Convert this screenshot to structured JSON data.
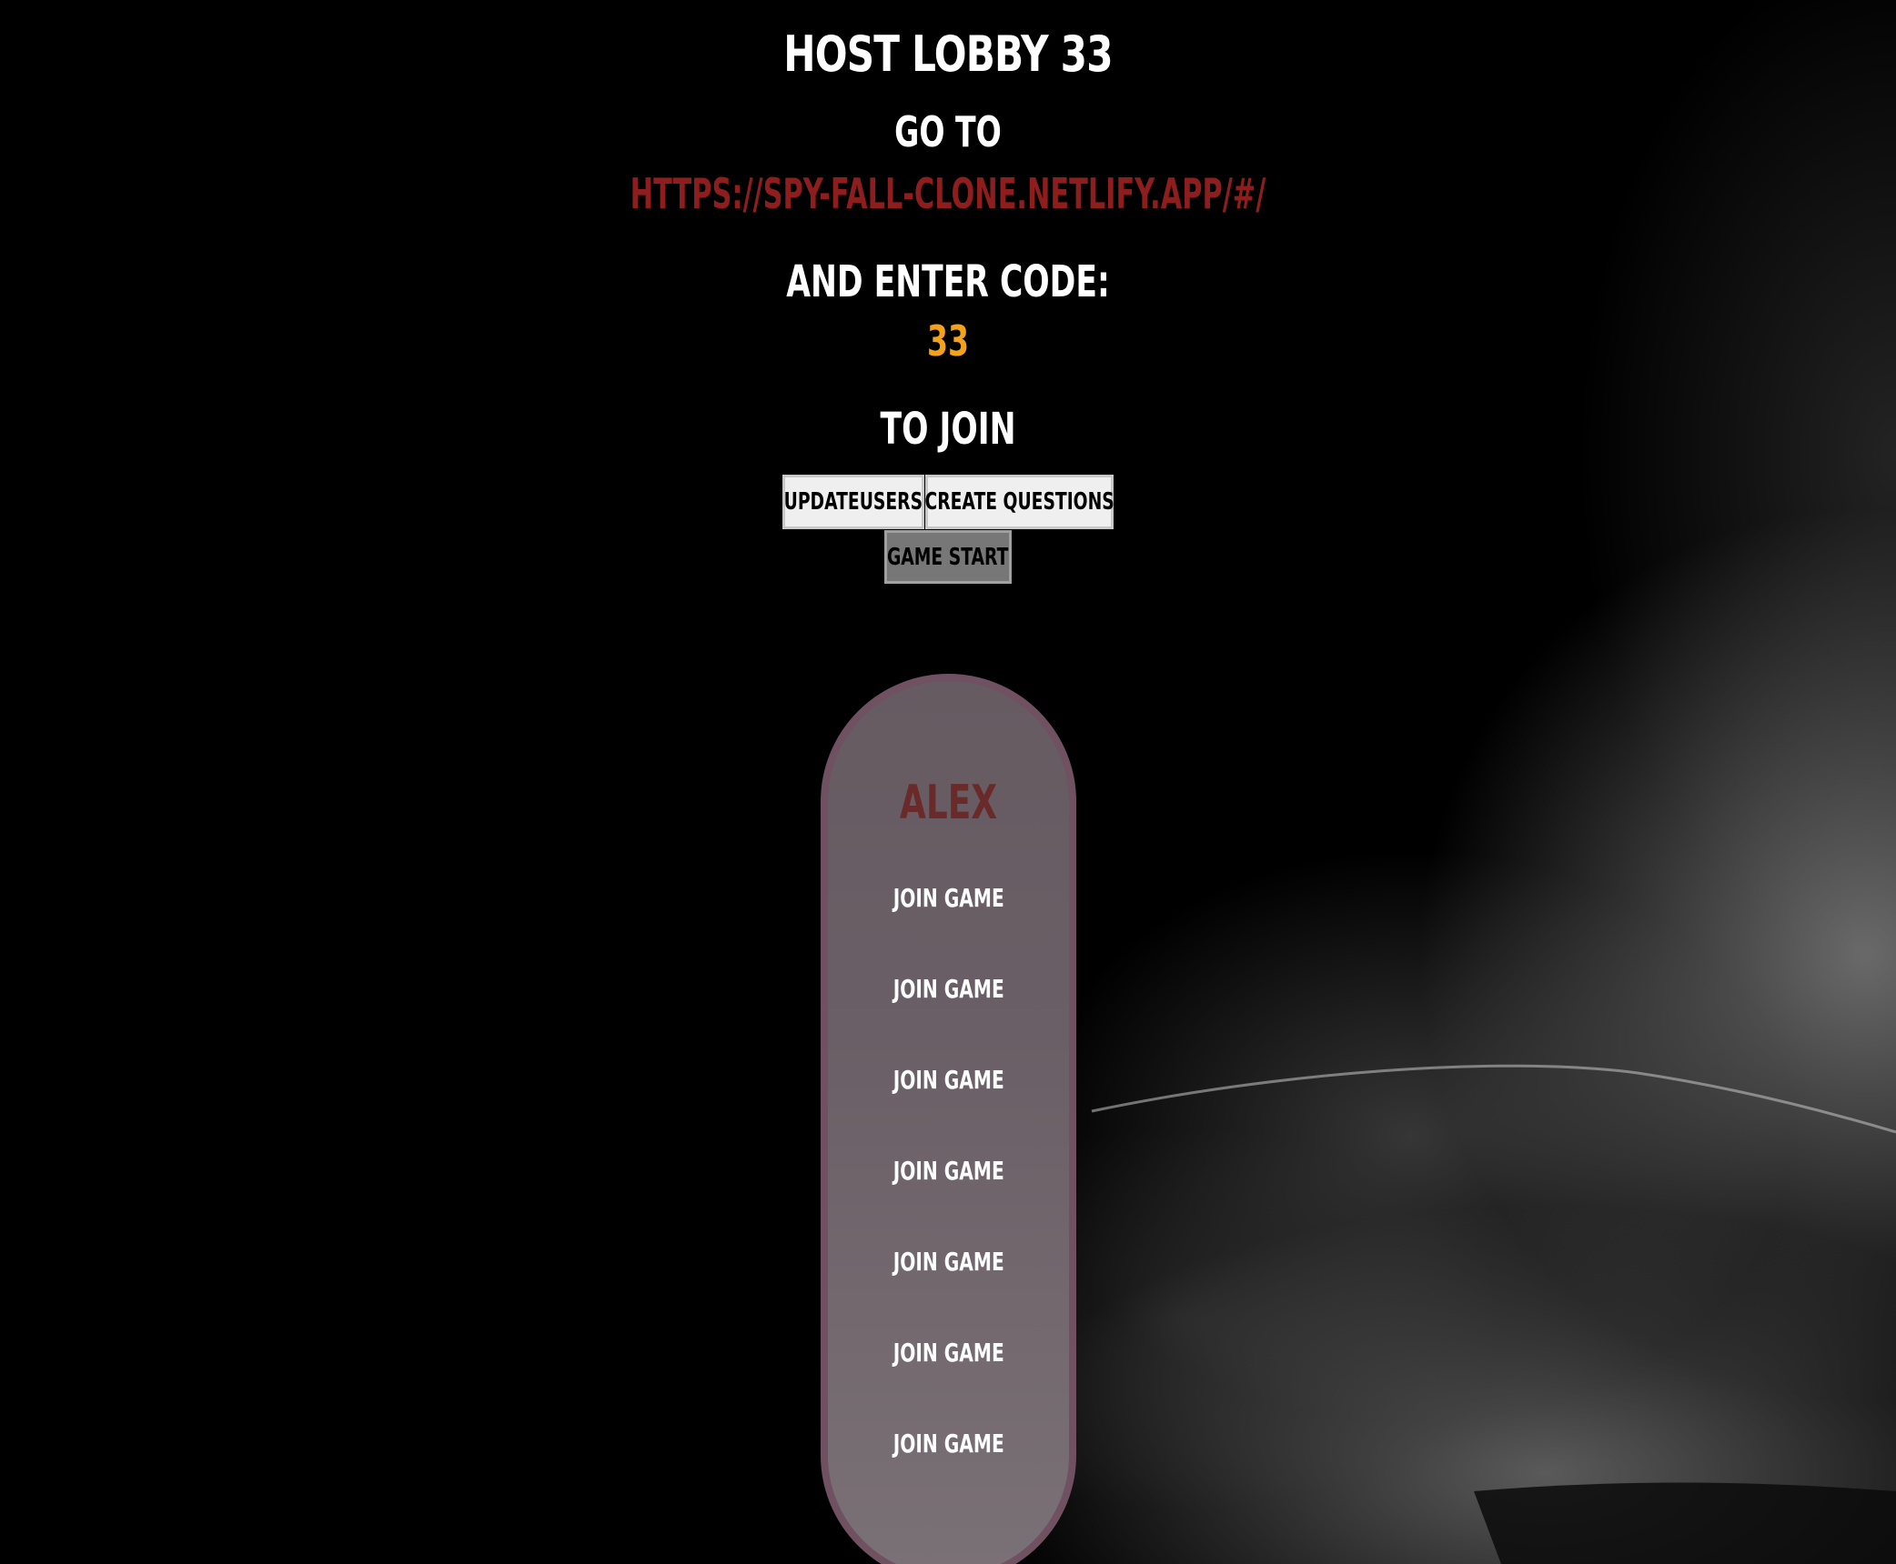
{
  "lobby": {
    "title": "HOST LOBBY 33",
    "go_to": "GO TO",
    "url": "HTTPS://SPY-FALL-CLONE.NETLIFY.APP/#/",
    "enter_code_label": "AND ENTER CODE:",
    "code": "33",
    "to_join": "TO JOIN"
  },
  "buttons": {
    "update_users": "UPDATEUSERS",
    "create_questions": "CREATE QUESTIONS",
    "game_start": "GAME START"
  },
  "players": {
    "name": "ALEX",
    "join_slots": [
      "JOIN GAME",
      "JOIN GAME",
      "JOIN GAME",
      "JOIN GAME",
      "JOIN GAME",
      "JOIN GAME",
      "JOIN GAME"
    ]
  },
  "colors": {
    "url": "#8e1d1d",
    "code": "#f4a21c",
    "player_name": "#6b2a2a",
    "pill_border": "#6f5161"
  }
}
